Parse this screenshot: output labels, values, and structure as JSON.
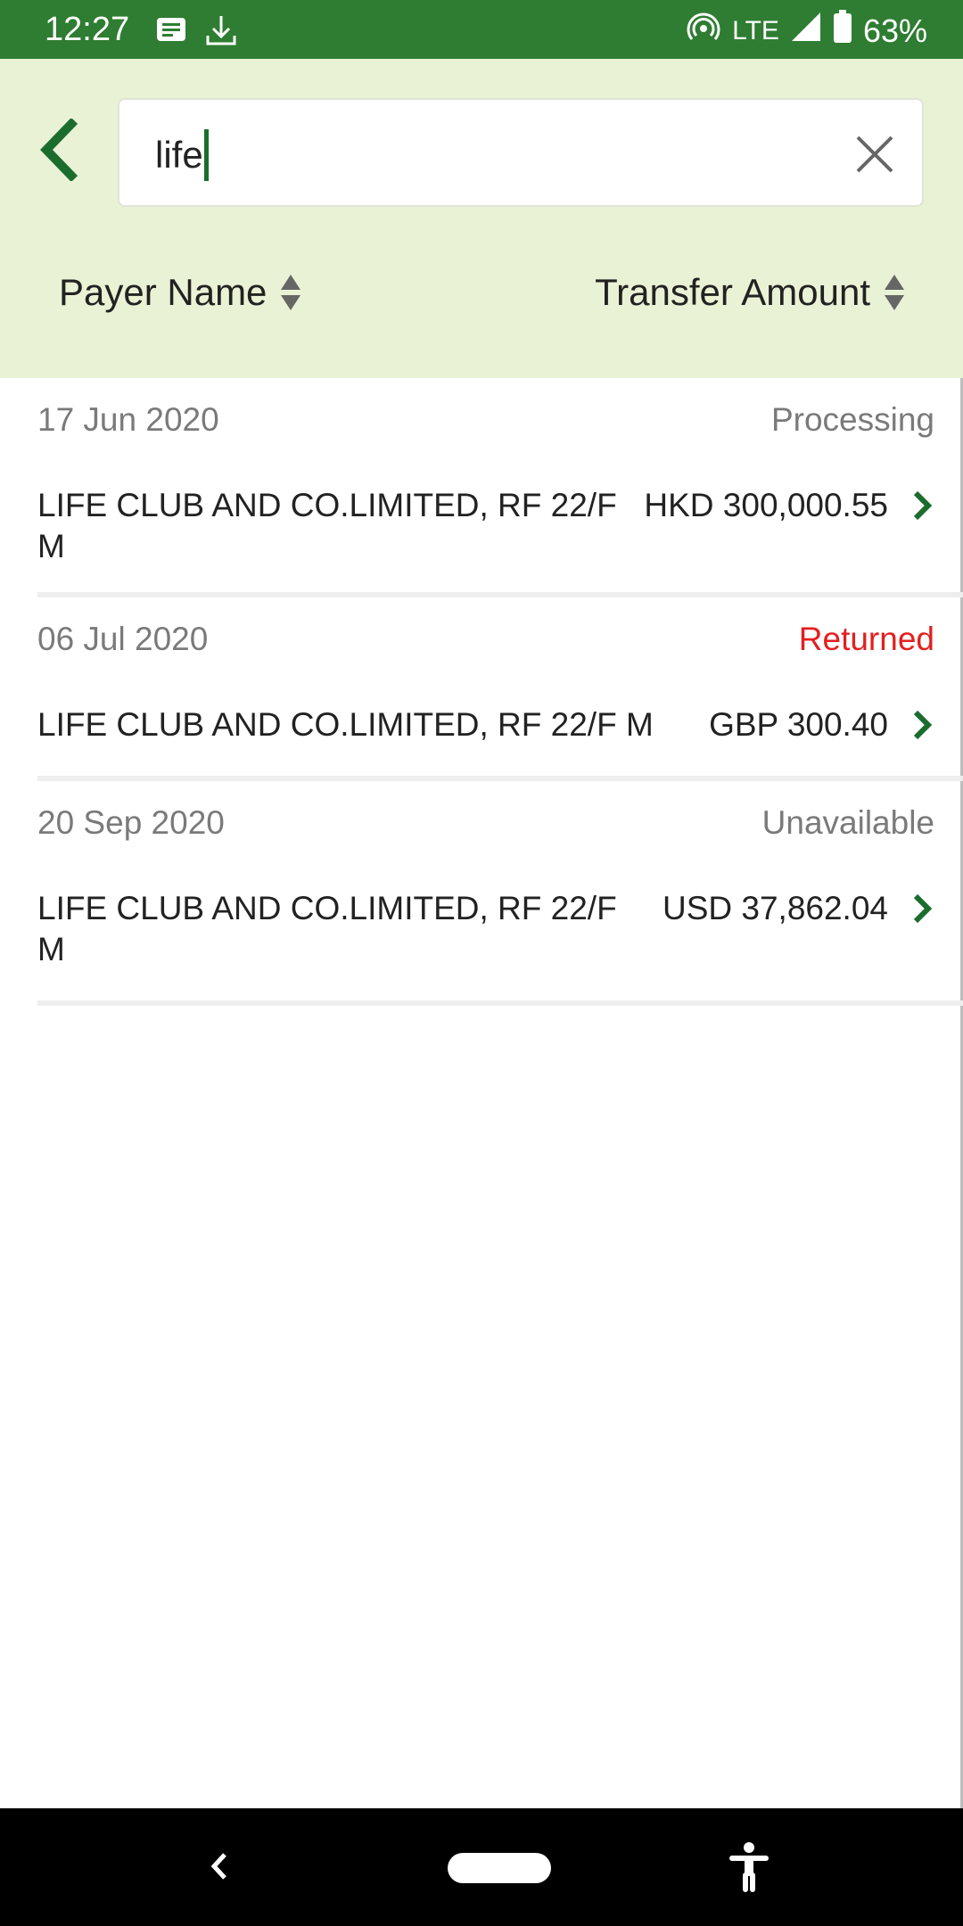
{
  "status_bar": {
    "time": "12:27",
    "network": "LTE",
    "battery": "63%",
    "icons": [
      "message-icon",
      "download-icon",
      "hotspot-icon",
      "signal-icon",
      "battery-icon"
    ]
  },
  "search": {
    "value": "life"
  },
  "sort": {
    "payer_label": "Payer Name",
    "amount_label": "Transfer Amount"
  },
  "colors": {
    "status_bar": "#2e7d32",
    "header_bg": "#eaf2d5",
    "accent": "#1b6d2e",
    "returned": "#e41f1f"
  },
  "results": [
    {
      "date": "17 Jun 2020",
      "status": "Processing",
      "payer": "LIFE CLUB AND CO.LIMITED, RF 22/F M",
      "amount": "HKD 300,000.55"
    },
    {
      "date": "06 Jul 2020",
      "status": "Returned",
      "payer": "LIFE CLUB AND CO.LIMITED, RF 22/F M",
      "amount": "GBP 300.40"
    },
    {
      "date": "20 Sep 2020",
      "status": "Unavailable",
      "payer": "LIFE CLUB AND CO.LIMITED, RF 22/F M",
      "amount": "USD 37,862.04"
    }
  ]
}
